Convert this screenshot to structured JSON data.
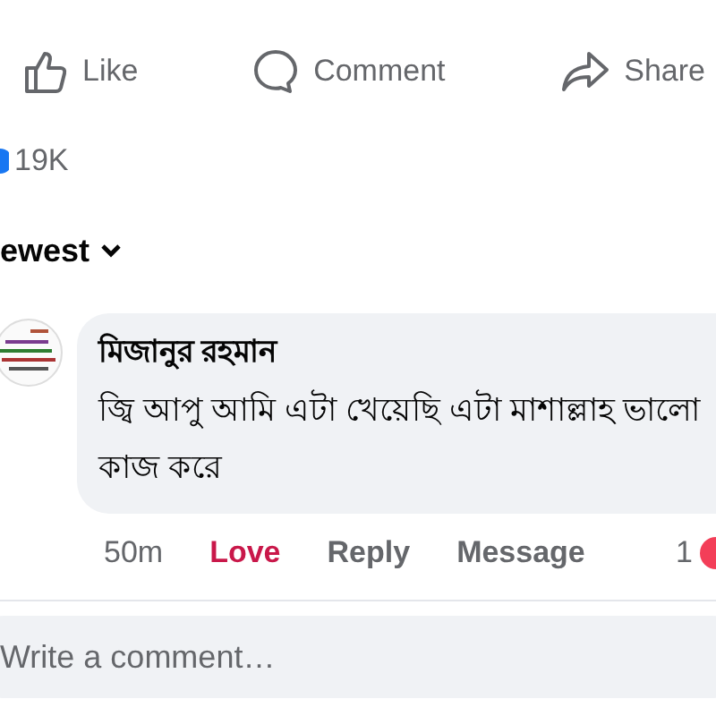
{
  "post_actions": [
    {
      "kind": "like",
      "label": "Like"
    },
    {
      "kind": "comment",
      "label": "Comment"
    },
    {
      "kind": "share",
      "label": "Share"
    }
  ],
  "reaction_count": "19K",
  "sort": {
    "label": "ewest"
  },
  "comments": [
    {
      "author": "মিজানুর রহমান",
      "text": "জ্বি আপু আমি এটা খেয়েছি এটা মাশাল্লাহ ভালো কাজ করে",
      "time": "50m",
      "reaction": {
        "label": "Love",
        "reacted": true
      },
      "reply": "Reply",
      "message": "Message",
      "reaction_total": "1"
    }
  ],
  "composer": {
    "placeholder": "Write a comment…"
  }
}
